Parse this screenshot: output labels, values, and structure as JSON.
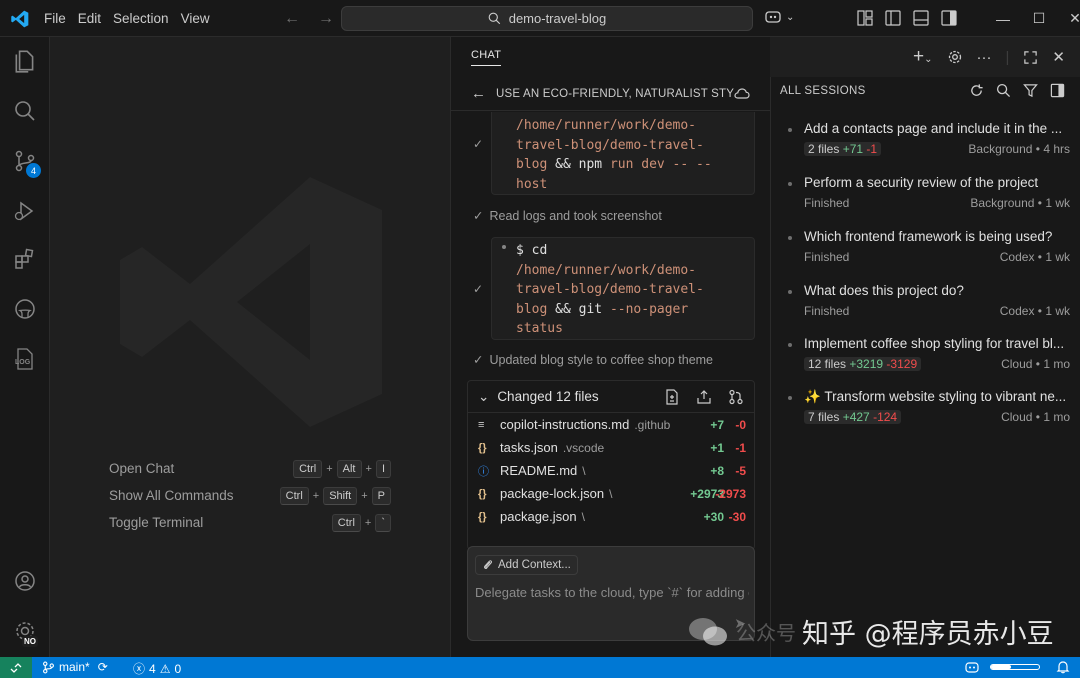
{
  "menu": [
    "File",
    "Edit",
    "Selection",
    "View"
  ],
  "command_center": {
    "text": "demo-travel-blog"
  },
  "activity": {
    "scm_badge": "4",
    "accounts_badge": "NO",
    "log_label": "LOG"
  },
  "welcome": {
    "shortcuts": [
      {
        "label": "Open Chat",
        "keys": [
          "Ctrl",
          "Alt",
          "I"
        ]
      },
      {
        "label": "Show All Commands",
        "keys": [
          "Ctrl",
          "Shift",
          "P"
        ]
      },
      {
        "label": "Toggle Terminal",
        "keys": [
          "Ctrl",
          "`"
        ]
      }
    ]
  },
  "chat": {
    "tab": "CHAT",
    "session_title": "USE AN ECO-FRIENDLY, NATURALIST STYLING ...",
    "cmd1": {
      "path_lines": [
        "/home/runner/work/demo-",
        "travel-blog/demo-travel-",
        "blog"
      ],
      "tail_op": "&&",
      "tail_cmd": "npm",
      "tail_args": "run dev -- --",
      "last": "host"
    },
    "step1": "Read logs and took screenshot",
    "cmd2": {
      "prefix": "$",
      "first": "cd",
      "path_lines": [
        "/home/runner/work/demo-",
        "travel-blog/demo-travel-",
        "blog"
      ],
      "tail_op": "&&",
      "tail_cmd": "git",
      "tail_args": "--no-pager",
      "last": "status"
    },
    "step2": "Updated blog style to coffee shop theme",
    "changed_title": "Changed 12 files",
    "files": [
      {
        "icon": "≡",
        "name": "copilot-instructions.md",
        "dir": ".github",
        "adds": "+7",
        "dels": "-0"
      },
      {
        "icon": "{}",
        "name": "tasks.json",
        "dir": ".vscode",
        "adds": "+1",
        "dels": "-1"
      },
      {
        "icon": "ⓘ",
        "name": "README.md",
        "dir": "\\",
        "adds": "+8",
        "dels": "-5"
      },
      {
        "icon": "{}",
        "name": "package-lock.json",
        "dir": "\\",
        "adds": "+2973",
        "dels": "-2973"
      },
      {
        "icon": "{}",
        "name": "package.json",
        "dir": "\\",
        "adds": "+30",
        "dels": "-30"
      }
    ],
    "add_context": "Add Context...",
    "placeholder": "Delegate tasks to the cloud, type `#` for adding context"
  },
  "sessions": {
    "title": "ALL SESSIONS",
    "items": [
      {
        "title": "Add a contacts page and include it in the ...",
        "files": "2 files",
        "adds": "+71",
        "dels": "-1",
        "status": "",
        "meta_right": "Background • 4 hrs",
        "spark": ""
      },
      {
        "title": "Perform a security review of the project",
        "files": "",
        "adds": "",
        "dels": "",
        "status": "Finished",
        "meta_right": "Background • 1 wk",
        "spark": ""
      },
      {
        "title": "Which frontend framework is being used?",
        "files": "",
        "adds": "",
        "dels": "",
        "status": "Finished",
        "meta_right": "Codex • 1 wk",
        "spark": ""
      },
      {
        "title": "What does this project do?",
        "files": "",
        "adds": "",
        "dels": "",
        "status": "Finished",
        "meta_right": "Codex • 1 wk",
        "spark": ""
      },
      {
        "title": "Implement coffee shop styling for travel bl...",
        "files": "12 files",
        "adds": "+3219",
        "dels": "-3129",
        "status": "",
        "meta_right": "Cloud • 1 mo",
        "spark": ""
      },
      {
        "title": "Transform website styling to vibrant ne...",
        "files": "7 files",
        "adds": "+427",
        "dels": "-124",
        "status": "",
        "meta_right": "Cloud • 1 mo",
        "spark": "✨"
      }
    ]
  },
  "statusbar": {
    "branch": "main*",
    "errors": "4",
    "warnings": "0"
  },
  "watermark": {
    "brand": "知乎 @程序员赤小豆",
    "faint": "公众号"
  },
  "colors": {
    "accent": "#0078d4",
    "added": "#73c991",
    "deleted": "#f14c4c"
  }
}
